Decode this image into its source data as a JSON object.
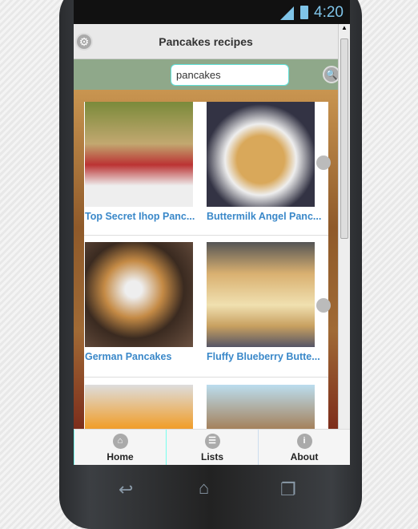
{
  "status": {
    "time": "4:20",
    "icons": [
      "signal-icon",
      "battery-icon"
    ]
  },
  "header": {
    "title": "Pancakes recipes",
    "settings_icon": "gear-icon"
  },
  "search": {
    "value": "pancakes",
    "icon": "search-icon"
  },
  "recipes": [
    {
      "title": "Top Secret Ihop Panc..."
    },
    {
      "title": "Buttermilk Angel Panc..."
    },
    {
      "title": "German Pancakes"
    },
    {
      "title": "Fluffy Blueberry Butte..."
    },
    {
      "title": ""
    },
    {
      "title": ""
    }
  ],
  "nav": [
    {
      "label": "Home",
      "icon": "home-icon"
    },
    {
      "label": "Lists",
      "icon": "list-icon"
    },
    {
      "label": "About",
      "icon": "info-icon"
    }
  ]
}
